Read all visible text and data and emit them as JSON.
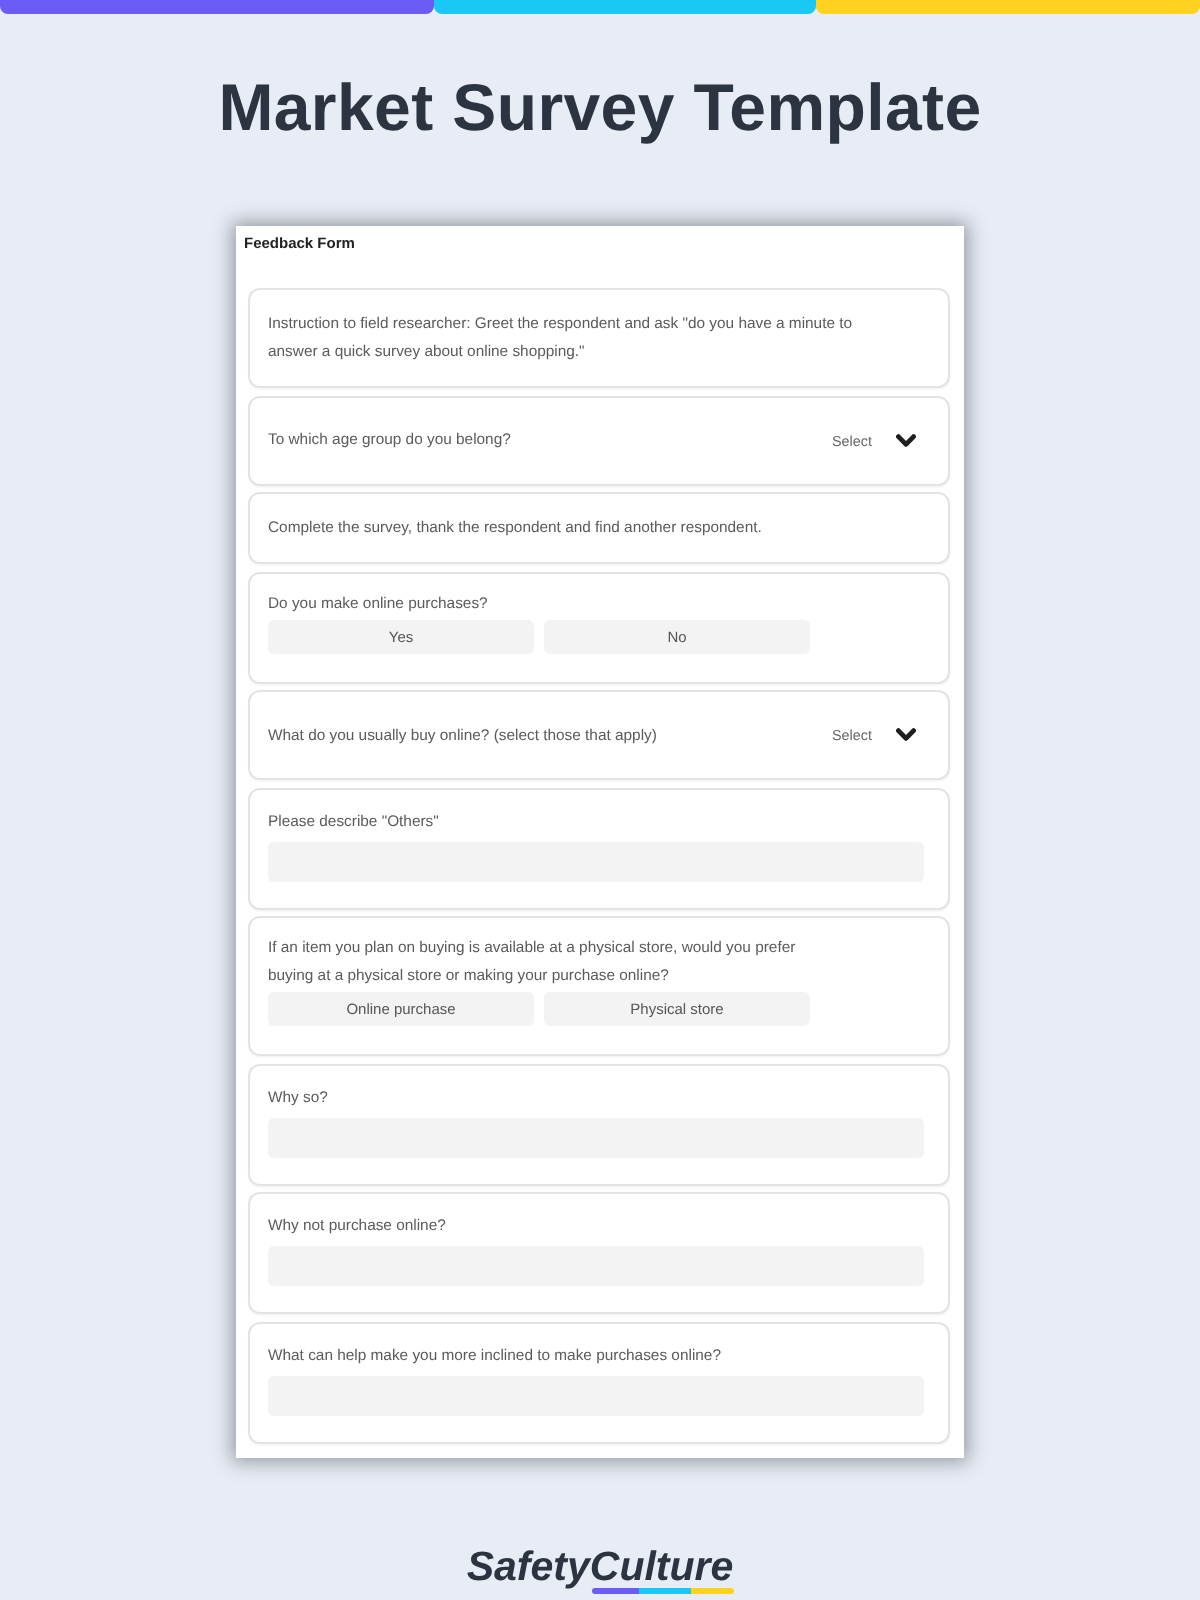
{
  "title": "Market Survey Template",
  "form": {
    "title": "Feedback Form",
    "items": [
      {
        "kind": "instruction",
        "text": "Instruction to field researcher: Greet the respondent and ask \"do you have a minute to answer a quick survey about online shopping.\""
      },
      {
        "kind": "select",
        "label": "To which age group do you belong?",
        "placeholder": "Select"
      },
      {
        "kind": "instruction",
        "text": "Complete the survey, thank the respondent and find another respondent."
      },
      {
        "kind": "choice",
        "label": "Do you make online purchases?",
        "options": [
          {
            "label": "Yes",
            "selected": false
          },
          {
            "label": "No",
            "selected": false
          }
        ]
      },
      {
        "kind": "select",
        "label": "What do you usually buy online? (select those that apply)",
        "placeholder": "Select"
      },
      {
        "kind": "text",
        "label": "Please describe \"Others\""
      },
      {
        "kind": "choice",
        "label": "If an item you plan on buying is available at a physical store, would you prefer buying at a physical store or making your purchase online?",
        "options": [
          {
            "label": "Online purchase",
            "selected": false
          },
          {
            "label": "Physical store",
            "selected": false
          }
        ]
      },
      {
        "kind": "text",
        "label": "Why so?"
      },
      {
        "kind": "text",
        "label": "Why not purchase online?"
      },
      {
        "kind": "text",
        "label": "What can help make you more inclined to make purchases online?"
      }
    ]
  },
  "brand": {
    "name": "SafetyCulture"
  }
}
